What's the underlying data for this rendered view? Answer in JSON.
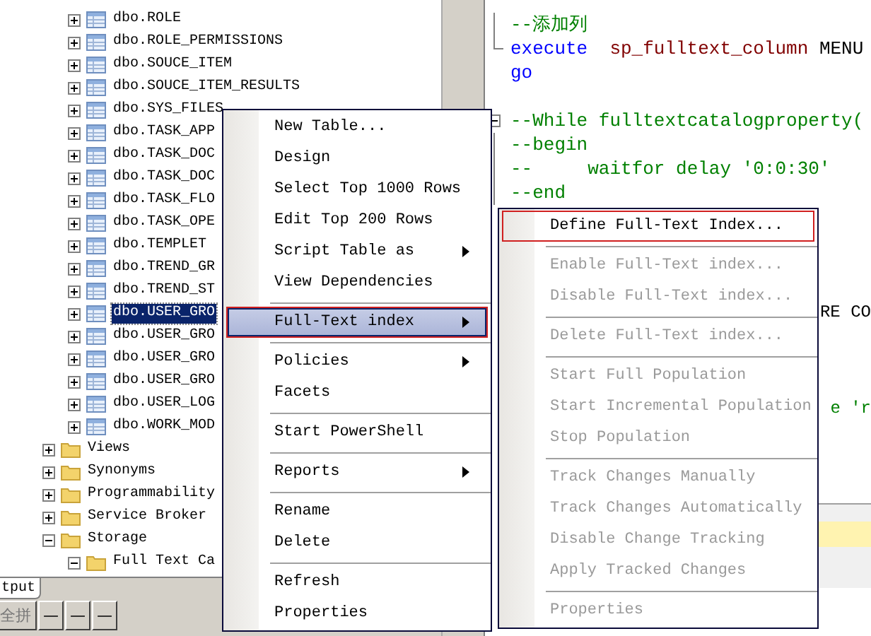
{
  "tree": {
    "table_rows": [
      {
        "label": "dbo.ROLE",
        "selected": false
      },
      {
        "label": "dbo.ROLE_PERMISSIONS",
        "selected": false
      },
      {
        "label": "dbo.SOUCE_ITEM",
        "selected": false
      },
      {
        "label": "dbo.SOUCE_ITEM_RESULTS",
        "selected": false
      },
      {
        "label": "dbo.SYS_FILES",
        "selected": false
      },
      {
        "label": "dbo.TASK_APP",
        "selected": false
      },
      {
        "label": "dbo.TASK_DOC",
        "selected": false
      },
      {
        "label": "dbo.TASK_DOC",
        "selected": false
      },
      {
        "label": "dbo.TASK_FLO",
        "selected": false
      },
      {
        "label": "dbo.TASK_OPE",
        "selected": false
      },
      {
        "label": "dbo.TEMPLET",
        "selected": false
      },
      {
        "label": "dbo.TREND_GR",
        "selected": false
      },
      {
        "label": "dbo.TREND_ST",
        "selected": false
      },
      {
        "label": "dbo.USER_GRO",
        "selected": true
      },
      {
        "label": "dbo.USER_GRO",
        "selected": false
      },
      {
        "label": "dbo.USER_GRO",
        "selected": false
      },
      {
        "label": "dbo.USER_GRO",
        "selected": false
      },
      {
        "label": "dbo.USER_LOG",
        "selected": false
      },
      {
        "label": "dbo.WORK_MOD",
        "selected": false
      }
    ],
    "folders": [
      {
        "label": "Views",
        "expanded": false
      },
      {
        "label": "Synonyms",
        "expanded": false
      },
      {
        "label": "Programmability",
        "expanded": false
      },
      {
        "label": "Service Broker",
        "expanded": false
      },
      {
        "label": "Storage",
        "expanded": true,
        "children": [
          {
            "label": "Full Text Ca",
            "expanded": true
          }
        ]
      }
    ]
  },
  "bottom_tabs": [
    {
      "label": "tput"
    }
  ],
  "ime_bar": {
    "buttons": [
      "全拼",
      "—",
      "—",
      "—"
    ]
  },
  "editor": {
    "lines": [
      {
        "kind": "fold_body",
        "segments": [
          {
            "text": "--添加列",
            "kind": "comment"
          }
        ]
      },
      {
        "kind": "fold_end",
        "segments": [
          {
            "text": "execute",
            "kind": "keyword"
          },
          {
            "text": "sp_fulltext_column",
            "kind": "proc"
          },
          {
            "text": "MENU",
            "kind": "plain"
          }
        ]
      },
      {
        "kind": "code",
        "segments": [
          {
            "text": "go",
            "kind": "keyword"
          }
        ]
      },
      {
        "kind": "blank"
      },
      {
        "kind": "fold_start",
        "segments": [
          {
            "text": "--While fulltextcatalogproperty(",
            "kind": "comment"
          }
        ]
      },
      {
        "kind": "fold_body",
        "segments": [
          {
            "text": "--begin",
            "kind": "comment"
          }
        ]
      },
      {
        "kind": "fold_body",
        "segments": [
          {
            "text": "--     waitfor delay '0:0:30'",
            "kind": "comment"
          }
        ]
      },
      {
        "kind": "fold_body",
        "segments": [
          {
            "text": "--end",
            "kind": "comment"
          }
        ]
      },
      {
        "kind": "blank"
      },
      {
        "kind": "blank"
      },
      {
        "kind": "blank"
      },
      {
        "kind": "blank"
      },
      {
        "kind": "tail",
        "segments": [
          {
            "text": "RE CO",
            "kind": "plain"
          }
        ]
      },
      {
        "kind": "blank"
      },
      {
        "kind": "blank"
      },
      {
        "kind": "blank"
      },
      {
        "kind": "tail",
        "segments": [
          {
            "text": "e 'r",
            "kind": "comment"
          }
        ]
      }
    ]
  },
  "context_menu": {
    "items": [
      {
        "kind": "item",
        "label": "New Table...",
        "submenu": false,
        "selected": false,
        "outlined": false
      },
      {
        "kind": "item",
        "label": "Design",
        "submenu": false,
        "selected": false,
        "outlined": false
      },
      {
        "kind": "item",
        "label": "Select Top 1000 Rows",
        "submenu": false,
        "selected": false,
        "outlined": false
      },
      {
        "kind": "item",
        "label": "Edit Top 200 Rows",
        "submenu": false,
        "selected": false,
        "outlined": false
      },
      {
        "kind": "item",
        "label": "Script Table as",
        "submenu": true,
        "selected": false,
        "outlined": false
      },
      {
        "kind": "item",
        "label": "View Dependencies",
        "submenu": false,
        "selected": false,
        "outlined": false
      },
      {
        "kind": "separator"
      },
      {
        "kind": "item",
        "label": "Full-Text index",
        "submenu": true,
        "selected": true,
        "outlined": true
      },
      {
        "kind": "separator"
      },
      {
        "kind": "item",
        "label": "Policies",
        "submenu": true,
        "selected": false,
        "outlined": false
      },
      {
        "kind": "item",
        "label": "Facets",
        "submenu": false,
        "selected": false,
        "outlined": false
      },
      {
        "kind": "separator"
      },
      {
        "kind": "item",
        "label": "Start PowerShell",
        "submenu": false,
        "selected": false,
        "outlined": false
      },
      {
        "kind": "separator"
      },
      {
        "kind": "item",
        "label": "Reports",
        "submenu": true,
        "selected": false,
        "outlined": false
      },
      {
        "kind": "separator"
      },
      {
        "kind": "item",
        "label": "Rename",
        "submenu": false,
        "selected": false,
        "outlined": false
      },
      {
        "kind": "item",
        "label": "Delete",
        "submenu": false,
        "selected": false,
        "outlined": false
      },
      {
        "kind": "separator"
      },
      {
        "kind": "item",
        "label": "Refresh",
        "submenu": false,
        "selected": false,
        "outlined": false
      },
      {
        "kind": "item",
        "label": "Properties",
        "submenu": false,
        "selected": false,
        "outlined": false
      }
    ]
  },
  "submenu": {
    "items": [
      {
        "kind": "item",
        "label": "Define Full-Text Index...",
        "disabled": false,
        "outlined": true
      },
      {
        "kind": "separator"
      },
      {
        "kind": "item",
        "label": "Enable Full-Text index...",
        "disabled": true,
        "outlined": false
      },
      {
        "kind": "item",
        "label": "Disable Full-Text index...",
        "disabled": true,
        "outlined": false
      },
      {
        "kind": "separator"
      },
      {
        "kind": "item",
        "label": "Delete Full-Text index...",
        "disabled": true,
        "outlined": false
      },
      {
        "kind": "separator"
      },
      {
        "kind": "item",
        "label": "Start Full Population",
        "disabled": true,
        "outlined": false
      },
      {
        "kind": "item",
        "label": "Start Incremental Population",
        "disabled": true,
        "outlined": false
      },
      {
        "kind": "item",
        "label": "Stop Population",
        "disabled": true,
        "outlined": false
      },
      {
        "kind": "separator"
      },
      {
        "kind": "item",
        "label": "Track Changes Manually",
        "disabled": true,
        "outlined": false
      },
      {
        "kind": "item",
        "label": "Track Changes Automatically",
        "disabled": true,
        "outlined": false
      },
      {
        "kind": "item",
        "label": "Disable Change Tracking",
        "disabled": true,
        "outlined": false
      },
      {
        "kind": "item",
        "label": "Apply Tracked Changes",
        "disabled": true,
        "outlined": false
      },
      {
        "kind": "separator"
      },
      {
        "kind": "item",
        "label": "Properties",
        "disabled": true,
        "outlined": false
      }
    ]
  }
}
